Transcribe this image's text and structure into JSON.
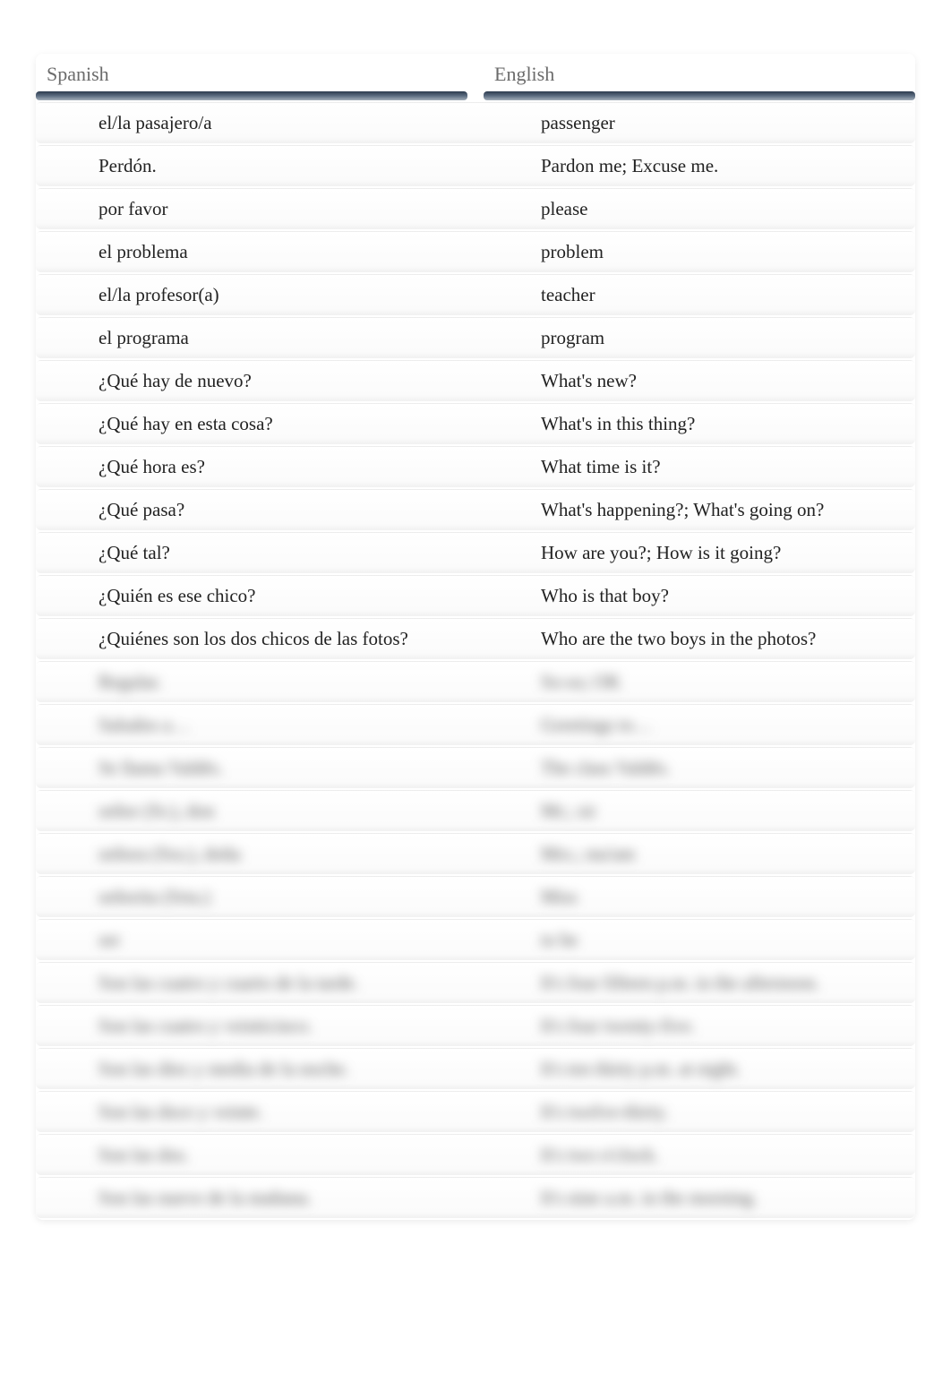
{
  "headers": {
    "left": "Spanish",
    "right": "English"
  },
  "rows_clear": [
    {
      "es": "el/la pasajero/a",
      "en": "passenger"
    },
    {
      "es": "Perdón.",
      "en": "Pardon me; Excuse me."
    },
    {
      "es": "por favor",
      "en": "please"
    },
    {
      "es": "el problema",
      "en": "problem"
    },
    {
      "es": "el/la profesor(a)",
      "en": "teacher"
    },
    {
      "es": "el programa",
      "en": "program"
    },
    {
      "es": "¿Qué hay de nuevo?",
      "en": "What's new?"
    },
    {
      "es": "¿Qué hay en esta cosa?",
      "en": "What's in this thing?"
    },
    {
      "es": "¿Qué hora es?",
      "en": "What time is it?"
    },
    {
      "es": "¿Qué pasa?",
      "en": "What's happening?; What's going on?"
    },
    {
      "es": "¿Qué tal?",
      "en": "How are you?; How is it going?"
    },
    {
      "es": "¿Quién es ese chico?",
      "en": "Who is that boy?"
    },
    {
      "es": "¿Quiénes son los dos chicos de las fotos?",
      "en": "Who are the two boys in the photos?"
    }
  ],
  "rows_blurred": [
    {
      "es": "Regular.",
      "en": "So-so; OK"
    },
    {
      "es": "Saludos a…",
      "en": "Greetings to…"
    },
    {
      "es": "Se llama Valdés.",
      "en": "The class Valdés."
    },
    {
      "es": "señor (Sr.), don",
      "en": "Mr.; sir"
    },
    {
      "es": "señora (Sra.), doña",
      "en": "Mrs.; ma'am"
    },
    {
      "es": "señorita (Srta.)",
      "en": "Miss"
    },
    {
      "es": "ser",
      "en": "to be"
    },
    {
      "es": "Son las cuatro y cuarto de la tarde.",
      "en": "It's four fifteen p.m. in the afternoon."
    },
    {
      "es": "Son las cuatro y veinticinco.",
      "en": "It's four twenty-five."
    },
    {
      "es": "Son las diez y media de la noche.",
      "en": "It's ten thirty p.m. at night."
    },
    {
      "es": "Son las doce y veinte.",
      "en": "It's twelve-thirty."
    },
    {
      "es": "Son las dos.",
      "en": "It's two o'clock."
    },
    {
      "es": "Son las nueve de la mañana.",
      "en": "It's nine a.m. in the morning."
    }
  ]
}
